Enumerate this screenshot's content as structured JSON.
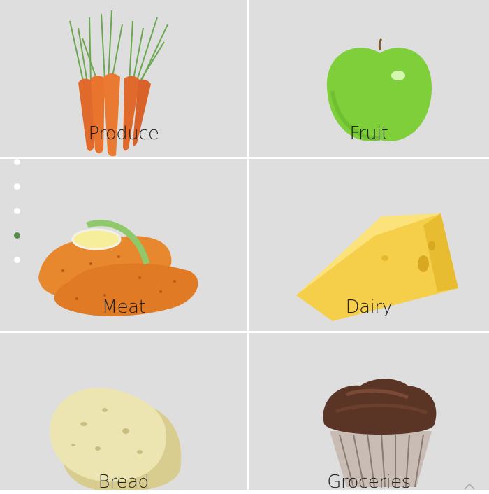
{
  "categories": [
    {
      "label": "Produce",
      "icon": "carrots-image"
    },
    {
      "label": "Fruit",
      "icon": "apple-image"
    },
    {
      "label": "Meat",
      "icon": "fried-chicken-image"
    },
    {
      "label": "Dairy",
      "icon": "cheese-image"
    },
    {
      "label": "Bread",
      "icon": "bread-image"
    },
    {
      "label": "Groceries",
      "icon": "cupcake-image"
    }
  ],
  "pager": {
    "count": 5,
    "active_index": 3
  },
  "colors": {
    "tile_bg": "#dedede",
    "accent": "#5a8a4a",
    "divider": "#ffffff"
  }
}
